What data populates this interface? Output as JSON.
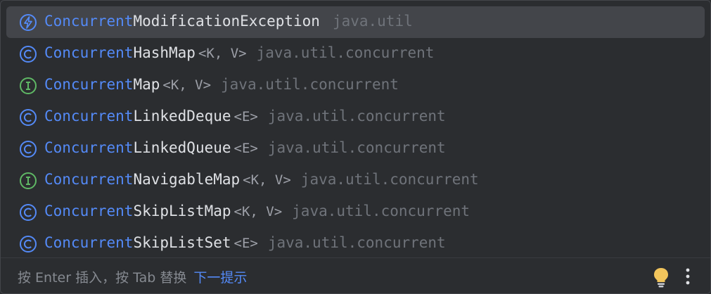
{
  "completion_items": [
    {
      "kind": "exception",
      "icon": "lightning-icon",
      "match": "Concurrent",
      "rest": "ModificationException",
      "generic": "",
      "package": "java.util",
      "selected": true
    },
    {
      "kind": "class",
      "icon": "class-icon",
      "match": "Concurrent",
      "rest": "HashMap",
      "generic": "<K, V>",
      "package": "java.util.concurrent",
      "selected": false
    },
    {
      "kind": "interface",
      "icon": "interface-icon",
      "match": "Concurrent",
      "rest": "Map",
      "generic": "<K, V>",
      "package": "java.util.concurrent",
      "selected": false
    },
    {
      "kind": "class",
      "icon": "class-icon",
      "match": "Concurrent",
      "rest": "LinkedDeque",
      "generic": "<E>",
      "package": "java.util.concurrent",
      "selected": false
    },
    {
      "kind": "class",
      "icon": "class-icon",
      "match": "Concurrent",
      "rest": "LinkedQueue",
      "generic": "<E>",
      "package": "java.util.concurrent",
      "selected": false
    },
    {
      "kind": "interface",
      "icon": "interface-icon",
      "match": "Concurrent",
      "rest": "NavigableMap",
      "generic": "<K, V>",
      "package": "java.util.concurrent",
      "selected": false
    },
    {
      "kind": "class",
      "icon": "class-icon",
      "match": "Concurrent",
      "rest": "SkipListMap",
      "generic": "<K, V>",
      "package": "java.util.concurrent",
      "selected": false
    },
    {
      "kind": "class",
      "icon": "class-icon",
      "match": "Concurrent",
      "rest": "SkipListSet",
      "generic": "<E>",
      "package": "java.util.concurrent",
      "selected": false
    }
  ],
  "footer": {
    "hint": "按 Enter 插入，按 Tab 替换",
    "next_tip_link": "下一提示",
    "bulb_icon": "lightbulb-icon",
    "more_icon": "more-vertical-icon"
  },
  "colors": {
    "background": "#2b2d30",
    "selected_row": "#43454a",
    "match": "#548af7",
    "text": "#dfe1e5",
    "package": "#6f737a",
    "class_icon": "#548af7",
    "interface_icon": "#5fb865",
    "bulb": "#f2c55c"
  }
}
